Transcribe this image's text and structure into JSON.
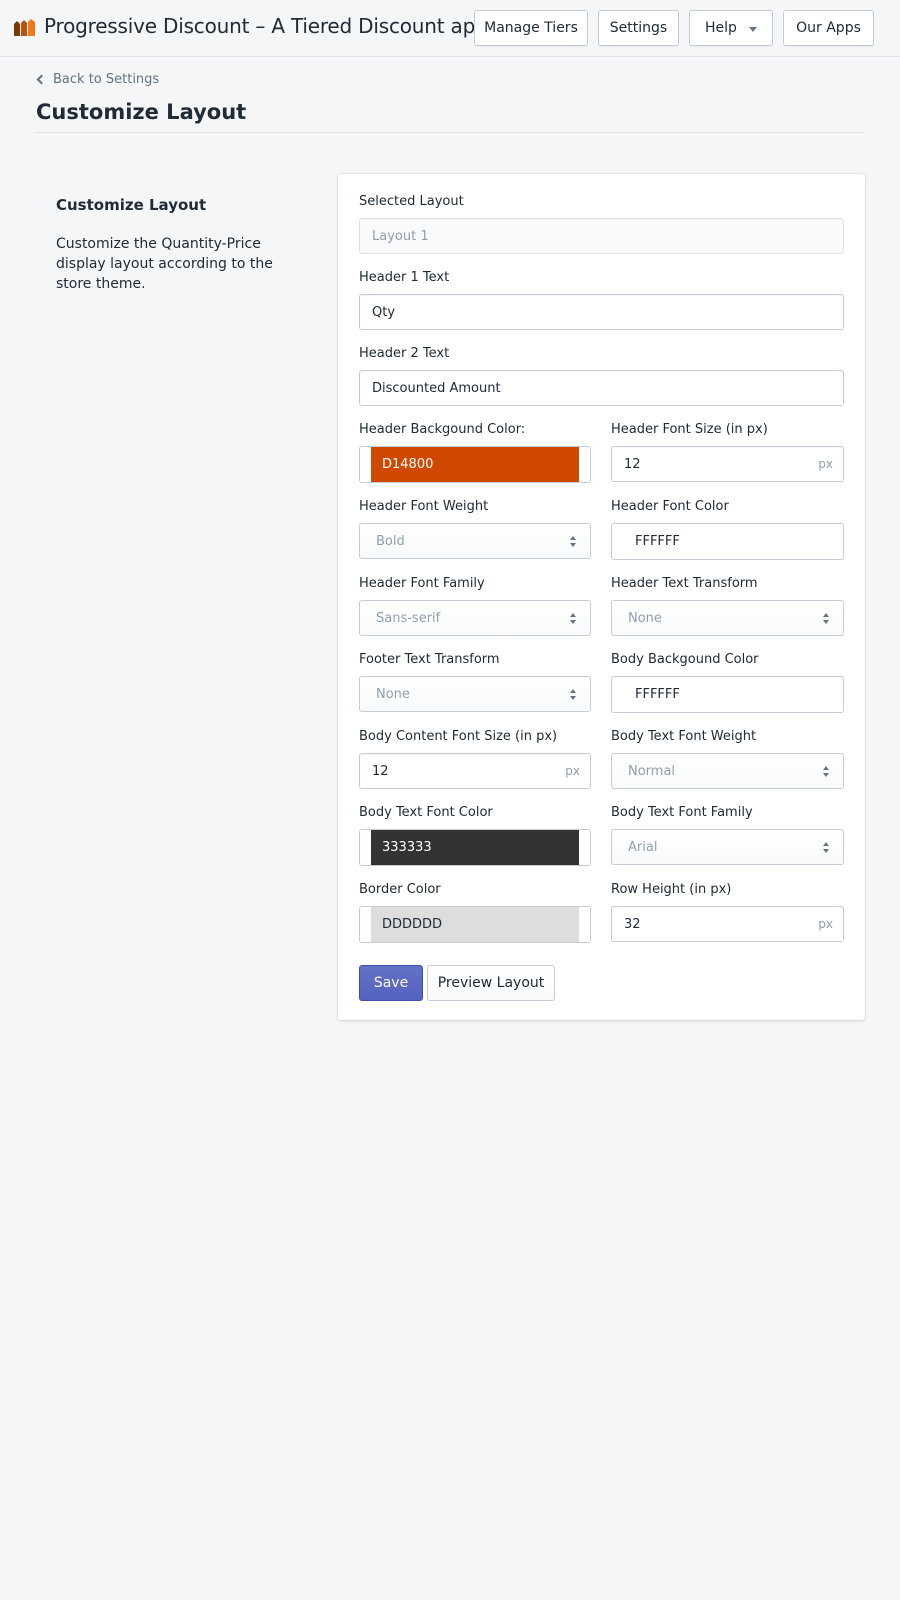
{
  "app": {
    "title": "Progressive Discount – A Tiered Discount app...",
    "logo_icon": "price-tags-icon",
    "logo_colors": [
      "#7a3a06",
      "#b9520d",
      "#f07a1a"
    ]
  },
  "nav": {
    "manage_tiers": "Manage Tiers",
    "settings": "Settings",
    "help": "Help",
    "our_apps": "Our Apps"
  },
  "breadcrumb": {
    "back_label": "Back to Settings",
    "icon": "chevron-left-icon"
  },
  "page_title": "Customize Layout",
  "section": {
    "title": "Customize Layout",
    "description": "Customize the Quantity-Price display layout according to the store theme."
  },
  "form": {
    "selected_layout": {
      "label": "Selected Layout",
      "value": "Layout 1"
    },
    "header1_text": {
      "label": "Header 1 Text",
      "value": "Qty"
    },
    "header2_text": {
      "label": "Header 2 Text",
      "value": "Discounted Amount"
    },
    "header_bg_color": {
      "label": "Header Backgound Color:",
      "value": "D14800",
      "swatch": "#D14800",
      "text_color": "#ffffff"
    },
    "header_font_size": {
      "label": "Header Font Size (in px)",
      "value": "12",
      "suffix": "px"
    },
    "header_font_weight": {
      "label": "Header Font Weight",
      "value": "Bold"
    },
    "header_font_color": {
      "label": "Header Font Color",
      "value": "FFFFFF"
    },
    "header_font_family": {
      "label": "Header Font Family",
      "value": "Sans-serif"
    },
    "header_text_transform": {
      "label": "Header Text Transform",
      "value": "None"
    },
    "footer_text_transform": {
      "label": "Footer Text Transform",
      "value": "None"
    },
    "body_bg_color": {
      "label": "Body Backgound Color",
      "value": "FFFFFF"
    },
    "body_font_size": {
      "label": "Body Content Font Size (in px)",
      "value": "12",
      "suffix": "px"
    },
    "body_font_weight": {
      "label": "Body Text Font Weight",
      "value": "Normal"
    },
    "body_font_color": {
      "label": "Body Text Font Color",
      "value": "333333",
      "swatch": "#333333",
      "text_color": "#ffffff"
    },
    "body_font_family": {
      "label": "Body Text Font Family",
      "value": "Arial"
    },
    "border_color": {
      "label": "Border Color",
      "value": "DDDDDD",
      "swatch": "#DDDDDD",
      "text_color": "#212b36"
    },
    "row_height": {
      "label": "Row Height (in px)",
      "value": "32",
      "suffix": "px"
    }
  },
  "actions": {
    "save": "Save",
    "preview": "Preview Layout"
  },
  "colors": {
    "primary": "#5c6ac4",
    "background": "#f4f6f8"
  }
}
